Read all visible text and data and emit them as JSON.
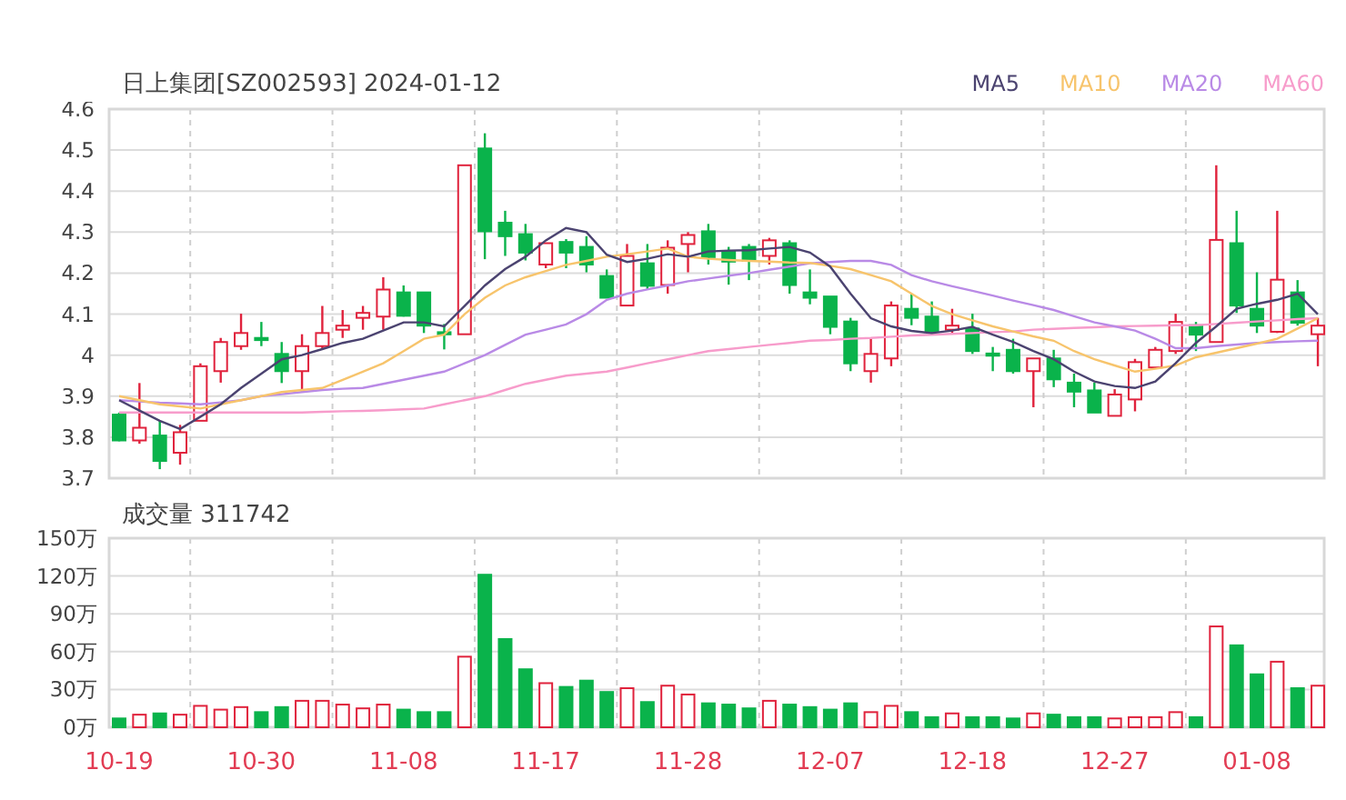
{
  "header": {
    "title": "日上集团[SZ002593] 2024-01-12"
  },
  "price_chart": {
    "chart_data": {
      "type": "candlestick",
      "grid": true,
      "ylim": [
        3.7,
        4.6
      ],
      "yticks": [
        3.7,
        3.8,
        3.9,
        {
          "value": 4.0,
          "label": "4"
        },
        4.1,
        4.2,
        4.3,
        4.4,
        4.5,
        4.6
      ],
      "categories": [
        null,
        null,
        null,
        null,
        null,
        null,
        null,
        null,
        null,
        null,
        null,
        null,
        null,
        null,
        null,
        null,
        null,
        null,
        null,
        null,
        null,
        null,
        null,
        null,
        null,
        null,
        null,
        null,
        null,
        null,
        null,
        null,
        null,
        null,
        null,
        null,
        null,
        null,
        null,
        null,
        null,
        null,
        null,
        null,
        null,
        null,
        null,
        null,
        null,
        null,
        null,
        null,
        null,
        null,
        null,
        null,
        null,
        null,
        null,
        null
      ],
      "ohlc": [
        [
          3.855,
          3.86,
          3.79,
          3.792
        ],
        [
          3.792,
          3.932,
          3.784,
          3.823
        ],
        [
          3.804,
          3.84,
          3.722,
          3.742
        ],
        [
          3.762,
          3.83,
          3.733,
          3.812
        ],
        [
          3.84,
          3.98,
          3.84,
          3.973
        ],
        [
          3.961,
          4.042,
          3.933,
          4.032
        ],
        [
          4.022,
          4.101,
          4.013,
          4.054
        ],
        [
          4.042,
          4.081,
          4.022,
          4.04
        ],
        [
          4.003,
          4.032,
          3.932,
          3.961
        ],
        [
          3.961,
          4.051,
          3.911,
          4.022
        ],
        [
          4.022,
          4.12,
          4.017,
          4.054
        ],
        [
          4.062,
          4.11,
          4.042,
          4.072
        ],
        [
          4.091,
          4.12,
          4.062,
          4.103
        ],
        [
          4.094,
          4.19,
          4.062,
          4.16
        ],
        [
          4.153,
          4.17,
          4.094,
          4.096
        ],
        [
          4.153,
          4.153,
          4.054,
          4.072
        ],
        [
          4.056,
          4.076,
          4.014,
          4.054
        ],
        [
          4.051,
          4.463,
          4.051,
          4.463
        ],
        [
          4.504,
          4.541,
          4.234,
          4.302
        ],
        [
          4.323,
          4.352,
          4.242,
          4.29
        ],
        [
          4.295,
          4.32,
          4.231,
          4.25
        ],
        [
          4.221,
          4.273,
          4.212,
          4.273
        ],
        [
          4.276,
          4.283,
          4.212,
          4.25
        ],
        [
          4.264,
          4.29,
          4.202,
          4.221
        ],
        [
          4.193,
          4.209,
          4.14,
          4.14
        ],
        [
          4.121,
          4.271,
          4.121,
          4.242
        ],
        [
          4.224,
          4.271,
          4.16,
          4.169
        ],
        [
          4.171,
          4.28,
          4.15,
          4.262
        ],
        [
          4.271,
          4.3,
          4.202,
          4.293
        ],
        [
          4.302,
          4.32,
          4.221,
          4.239
        ],
        [
          4.253,
          4.264,
          4.172,
          4.228
        ],
        [
          4.264,
          4.271,
          4.183,
          4.23
        ],
        [
          4.242,
          4.286,
          4.221,
          4.28
        ],
        [
          4.273,
          4.28,
          4.15,
          4.171
        ],
        [
          4.153,
          4.209,
          4.124,
          4.14
        ],
        [
          4.143,
          4.143,
          4.051,
          4.069
        ],
        [
          4.082,
          4.091,
          3.961,
          3.98
        ],
        [
          3.961,
          4.04,
          3.933,
          4.003
        ],
        [
          3.992,
          4.131,
          3.973,
          4.121
        ],
        [
          4.113,
          4.15,
          4.073,
          4.091
        ],
        [
          4.094,
          4.131,
          4.051,
          4.059
        ],
        [
          4.062,
          4.113,
          4.051,
          4.072
        ],
        [
          4.065,
          4.101,
          4.003,
          4.01
        ],
        [
          4.004,
          4.02,
          3.961,
          4.003
        ],
        [
          4.013,
          4.04,
          3.955,
          3.961
        ],
        [
          3.961,
          3.992,
          3.873,
          3.992
        ],
        [
          3.992,
          4.013,
          3.922,
          3.941
        ],
        [
          3.933,
          3.955,
          3.873,
          3.911
        ],
        [
          3.914,
          3.933,
          3.86,
          3.86
        ],
        [
          3.852,
          3.917,
          3.852,
          3.904
        ],
        [
          3.892,
          3.991,
          3.863,
          3.983
        ],
        [
          3.97,
          4.02,
          3.97,
          4.013
        ],
        [
          4.01,
          4.101,
          4.003,
          4.081
        ],
        [
          4.073,
          4.081,
          4.01,
          4.05
        ],
        [
          4.032,
          4.463,
          4.032,
          4.281
        ],
        [
          4.273,
          4.352,
          4.103,
          4.121
        ],
        [
          4.113,
          4.202,
          4.054,
          4.072
        ],
        [
          4.057,
          4.352,
          4.054,
          4.184
        ],
        [
          4.153,
          4.183,
          4.072,
          4.079
        ],
        [
          4.051,
          4.091,
          3.973,
          4.072
        ]
      ]
    },
    "moving_average_chart": {
      "chart_data": {
        "type": "line",
        "ylim": [
          3.7,
          4.6
        ],
        "categories": [
          null,
          null,
          null,
          null,
          null,
          null,
          null,
          null,
          null,
          null,
          null,
          null,
          null,
          null,
          null,
          null,
          null,
          null,
          null,
          null,
          null,
          null,
          null,
          null,
          null,
          null,
          null,
          null,
          null,
          null,
          null,
          null,
          null,
          null,
          null,
          null,
          null,
          null,
          null,
          null,
          null,
          null,
          null,
          null,
          null,
          null,
          null,
          null,
          null,
          null,
          null,
          null,
          null,
          null,
          null,
          null,
          null,
          null,
          null,
          null
        ],
        "series": [
          {
            "name": "MA5",
            "color": "#4b4370",
            "values": [
              3.89,
              3.865,
              3.84,
              3.82,
              3.85,
              3.88,
              3.92,
              3.955,
              3.99,
              4.0,
              4.015,
              4.03,
              4.04,
              4.06,
              4.08,
              4.08,
              4.07,
              4.12,
              4.17,
              4.21,
              4.24,
              4.28,
              4.31,
              4.3,
              4.245,
              4.227,
              4.235,
              4.246,
              4.24,
              4.253,
              4.255,
              4.256,
              4.26,
              4.264,
              4.25,
              4.216,
              4.15,
              4.09,
              4.07,
              4.059,
              4.054,
              4.06,
              4.069,
              4.05,
              4.032,
              4.01,
              3.99,
              3.96,
              3.936,
              3.925,
              3.92,
              3.936,
              3.98,
              4.03,
              4.07,
              4.113,
              4.125,
              4.135,
              4.15,
              4.1
            ]
          },
          {
            "name": "MA10",
            "color": "#f7c46c",
            "values": [
              3.9,
              3.89,
              3.88,
              3.875,
              3.87,
              3.88,
              3.89,
              3.9,
              3.91,
              3.915,
              3.92,
              3.94,
              3.96,
              3.98,
              4.01,
              4.04,
              4.05,
              4.1,
              4.14,
              4.17,
              4.19,
              4.205,
              4.22,
              4.23,
              4.24,
              4.246,
              4.253,
              4.26,
              4.24,
              4.235,
              4.232,
              4.23,
              4.228,
              4.226,
              4.225,
              4.218,
              4.21,
              4.195,
              4.18,
              4.15,
              4.12,
              4.1,
              4.085,
              4.07,
              4.058,
              4.046,
              4.035,
              4.01,
              3.99,
              3.975,
              3.96,
              3.967,
              3.975,
              3.995,
              4.006,
              4.017,
              4.028,
              4.04,
              4.065,
              4.09
            ]
          },
          {
            "name": "MA20",
            "color": "#b98ae6",
            "values": [
              3.89,
              3.887,
              3.884,
              3.882,
              3.88,
              3.885,
              3.89,
              3.9,
              3.905,
              3.91,
              3.915,
              3.918,
              3.92,
              3.93,
              3.94,
              3.95,
              3.96,
              3.98,
              4.0,
              4.025,
              4.05,
              4.062,
              4.075,
              4.1,
              4.135,
              4.15,
              4.16,
              4.17,
              4.18,
              4.187,
              4.194,
              4.2,
              4.208,
              4.216,
              4.224,
              4.227,
              4.23,
              4.23,
              4.22,
              4.195,
              4.18,
              4.168,
              4.157,
              4.145,
              4.133,
              4.122,
              4.11,
              4.095,
              4.08,
              4.07,
              4.06,
              4.04,
              4.017,
              4.017,
              4.022,
              4.026,
              4.03,
              4.032,
              4.034,
              4.035
            ]
          },
          {
            "name": "MA60",
            "color": "#f79ccb",
            "values": [
              3.86,
              3.86,
              3.86,
              3.86,
              3.86,
              3.86,
              3.86,
              3.86,
              3.86,
              3.86,
              3.862,
              3.863,
              3.864,
              3.866,
              3.868,
              3.87,
              3.88,
              3.89,
              3.9,
              3.915,
              3.93,
              3.94,
              3.95,
              3.955,
              3.96,
              3.97,
              3.98,
              3.99,
              4.0,
              4.01,
              4.015,
              4.02,
              4.025,
              4.03,
              4.035,
              4.037,
              4.04,
              4.042,
              4.045,
              4.048,
              4.05,
              4.052,
              4.054,
              4.056,
              4.058,
              4.062,
              4.064,
              4.066,
              4.068,
              4.07,
              4.071,
              4.072,
              4.073,
              4.073,
              4.076,
              4.079,
              4.082,
              4.085,
              4.088,
              4.09
            ]
          }
        ]
      }
    }
  },
  "volume_chart": {
    "label": "成交量 311742",
    "chart_data": {
      "type": "bar",
      "grid": true,
      "ylim": [
        0,
        150
      ],
      "yticks": [
        {
          "value": 0,
          "label": "0万"
        },
        {
          "value": 30,
          "label": "30万"
        },
        {
          "value": 60,
          "label": "60万"
        },
        {
          "value": 90,
          "label": "90万"
        },
        {
          "value": 120,
          "label": "120万"
        },
        {
          "value": 150,
          "label": "150万"
        }
      ],
      "categories": [
        "10-19",
        null,
        null,
        null,
        null,
        null,
        null,
        "10-30",
        null,
        null,
        null,
        null,
        null,
        null,
        "11-08",
        null,
        null,
        null,
        null,
        null,
        null,
        "11-17",
        null,
        null,
        null,
        null,
        null,
        null,
        "11-28",
        null,
        null,
        null,
        null,
        null,
        null,
        "12-07",
        null,
        null,
        null,
        null,
        null,
        null,
        "12-18",
        null,
        null,
        null,
        null,
        null,
        null,
        "12-27",
        null,
        null,
        null,
        null,
        null,
        null,
        "01-08",
        null,
        null,
        null
      ],
      "values": [
        7,
        10,
        11,
        10,
        17,
        14,
        16,
        12,
        16,
        21,
        21,
        18,
        15,
        18,
        14,
        12,
        12,
        56,
        121,
        70,
        46,
        35,
        32,
        37,
        28,
        31,
        20,
        33,
        26,
        19,
        18,
        15,
        21,
        18,
        16,
        14,
        19,
        12,
        17,
        12,
        8,
        11,
        8,
        8,
        7,
        11,
        10,
        8,
        8,
        7,
        8,
        8,
        12,
        8,
        80,
        65,
        42,
        52,
        31,
        33
      ]
    }
  }
}
